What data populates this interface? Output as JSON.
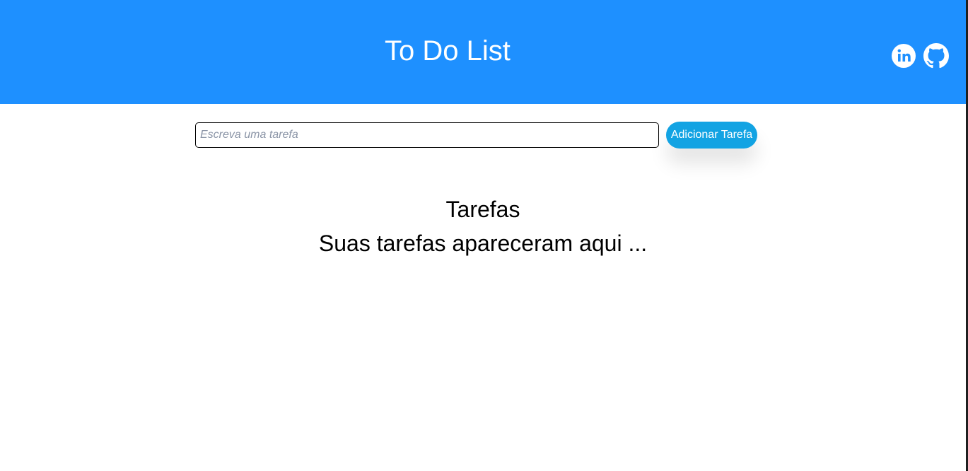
{
  "header": {
    "title": "To Do List",
    "background_color": "#1e90ff",
    "social_links": [
      {
        "icon": "linkedin-icon"
      },
      {
        "icon": "github-icon"
      }
    ]
  },
  "task_form": {
    "input": {
      "value": "",
      "placeholder": "Escreva uma tarefa"
    },
    "add_button_label": "Adicionar Tarefa",
    "add_button_color": "#12a3e3"
  },
  "tasks": {
    "title": "Tarefas",
    "empty_message": "Suas tarefas apareceram aqui ...",
    "items": []
  }
}
